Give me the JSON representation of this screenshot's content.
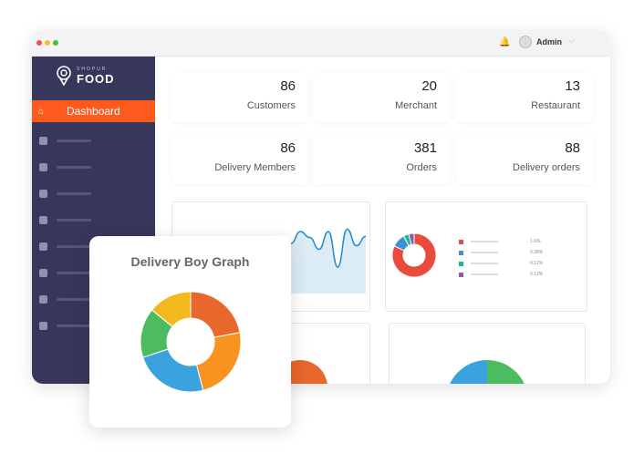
{
  "colors": {
    "accent": "#fe5a1d",
    "sidebar": "#37375b"
  },
  "header": {
    "notification_icon": "bell-icon",
    "user_name": "Admin",
    "user_icon": "user-avatar-icon",
    "dropdown_icon": "chevron-down-icon"
  },
  "sidebar": {
    "logo_top": "SHOPUR",
    "logo_main": "FOOD",
    "active": {
      "label": "Dashboard",
      "icon": "home-icon"
    },
    "icons": [
      "square-icon",
      "user-icon",
      "gear-icon",
      "tag-icon",
      "user-icon",
      "bar-chart-icon",
      "gear-icon",
      "location-icon"
    ]
  },
  "stats": [
    {
      "value": "86",
      "label": "Customers",
      "icon": "users-icon"
    },
    {
      "value": "20",
      "label": "Merchant",
      "icon": "users-icon"
    },
    {
      "value": "13",
      "label": "Restaurant",
      "icon": "fork-knife-icon"
    },
    {
      "value": "86",
      "label": "Delivery Members",
      "icon": "users-icon"
    },
    {
      "value": "381",
      "label": "Orders",
      "icon": "cart-icon"
    },
    {
      "value": "88",
      "label": "Delivery orders",
      "icon": "cart-icon"
    }
  ],
  "chart_data": [
    {
      "type": "pie",
      "title": "Delivery Boy Graph",
      "values": [
        22,
        24,
        24,
        16,
        14
      ],
      "colors": [
        "#e8672a",
        "#f7931e",
        "#3aa3dd",
        "#4dbb5f",
        "#f2b81e"
      ]
    },
    {
      "type": "pie",
      "values": [
        82,
        10,
        4,
        4
      ],
      "legend": [
        "1.6%",
        "0.28%",
        "0.12%",
        "0.12%"
      ],
      "colors": [
        "#e94b3c",
        "#3a8fd6",
        "#1fb58f",
        "#8e58b6"
      ]
    },
    {
      "type": "area",
      "values": [
        5,
        6,
        5.5,
        4.5,
        6,
        3,
        6.2,
        4.8,
        5.6
      ],
      "color": "#1f8ccc"
    }
  ]
}
